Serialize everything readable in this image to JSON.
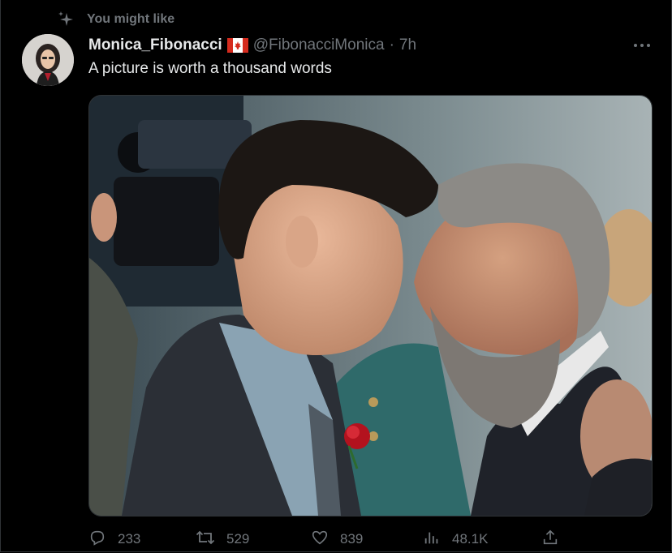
{
  "context": {
    "label": "You might like",
    "icon": "sparkle-icon"
  },
  "tweet": {
    "author_name": "Monica_Fibonacci",
    "flag_icon": "canada-flag-icon",
    "handle": "@FibonacciMonica",
    "separator": "·",
    "time": "7h",
    "text": "A picture is worth a thousand words"
  },
  "media": {
    "alt_icon": "photo-image"
  },
  "actions": {
    "replies": "233",
    "retweets": "529",
    "likes": "839",
    "views": "48.1K"
  },
  "colors": {
    "background": "#000000",
    "text_primary": "#e7e9ea",
    "text_secondary": "#71767b",
    "flag_red": "#d52b1e"
  }
}
